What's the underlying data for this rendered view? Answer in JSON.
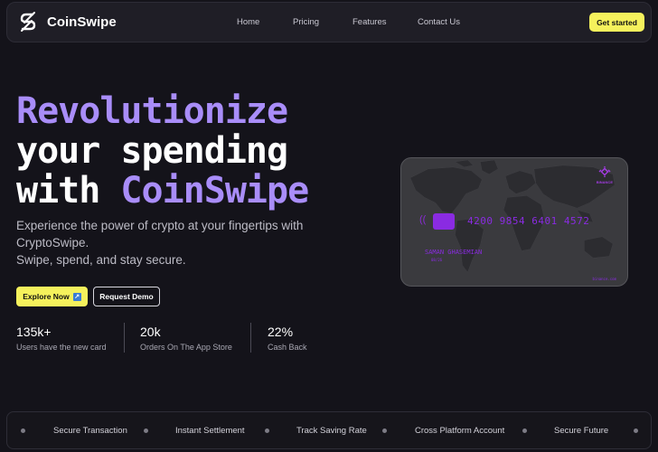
{
  "brand": {
    "name": "CoinSwipe",
    "logo_icon": "coinswipe-s-logo"
  },
  "nav": {
    "links": [
      "Home",
      "Pricing",
      "Features",
      "Contact Us"
    ],
    "cta": "Get started"
  },
  "hero": {
    "title_line1": "Revolutionize",
    "title_line2": "your spending",
    "title_line3_a": "with ",
    "title_line3_b": "CoinSwipe",
    "subtitle_line1": "Experience the power of crypto at your fingertips with",
    "subtitle_line2": "CryptoSwipe.",
    "subtitle_line3": "Swipe, spend, and stay secure.",
    "primary_button": "Explore Now",
    "primary_button_icon": "external-link-icon",
    "secondary_button": "Request Demo"
  },
  "stats": [
    {
      "value": "135k+",
      "label": "Users have the new card"
    },
    {
      "value": "20k",
      "label": "Orders On The App Store"
    },
    {
      "value": "22%",
      "label": "Cash Back"
    }
  ],
  "card": {
    "brand_text": "BINANCE",
    "number": "4200 9854 6401 4572",
    "holder": "SAMAN GHASEMIAN",
    "expiry": "08/26",
    "site": "binance.com"
  },
  "features": [
    "Secure Transaction",
    "Instant Settlement",
    "Track Saving Rate",
    "Cross Platform Account",
    "Secure Future"
  ],
  "colors": {
    "background": "#14131a",
    "accent_yellow": "#f5f15c",
    "accent_purple": "#a98df9",
    "card_purple": "#8a2be2"
  }
}
